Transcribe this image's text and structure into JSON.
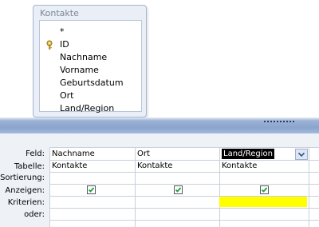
{
  "table_box": {
    "title": "Kontakte",
    "fields": [
      {
        "label": "*",
        "key": false
      },
      {
        "label": "ID",
        "key": true
      },
      {
        "label": "Nachname",
        "key": false
      },
      {
        "label": "Vorname",
        "key": false
      },
      {
        "label": "Geburtsdatum",
        "key": false
      },
      {
        "label": "Ort",
        "key": false
      },
      {
        "label": "Land/Region",
        "key": false
      }
    ]
  },
  "grid": {
    "row_labels": [
      "Feld:",
      "Tabelle:",
      "Sortierung:",
      "Anzeigen:",
      "Kriterien:",
      "oder:"
    ],
    "columns": [
      {
        "field": "Nachname",
        "table": "Kontakte",
        "sort": "",
        "show": true,
        "criteria": "",
        "or": ""
      },
      {
        "field": "Ort",
        "table": "Kontakte",
        "sort": "",
        "show": true,
        "criteria": "",
        "or": ""
      },
      {
        "field": "Land/Region",
        "table": "Kontakte",
        "sort": "",
        "show": true,
        "criteria": "",
        "or": ""
      }
    ],
    "selected_field": "Land/Region"
  },
  "colors": {
    "criteria_highlight": "#ffff00",
    "splitter": "#8aa4cd",
    "selection_background": "#000000"
  },
  "icons": {
    "primary_key": "key-icon",
    "checkbox": "checkmark-icon",
    "dropdown": "chevron-down-icon"
  }
}
